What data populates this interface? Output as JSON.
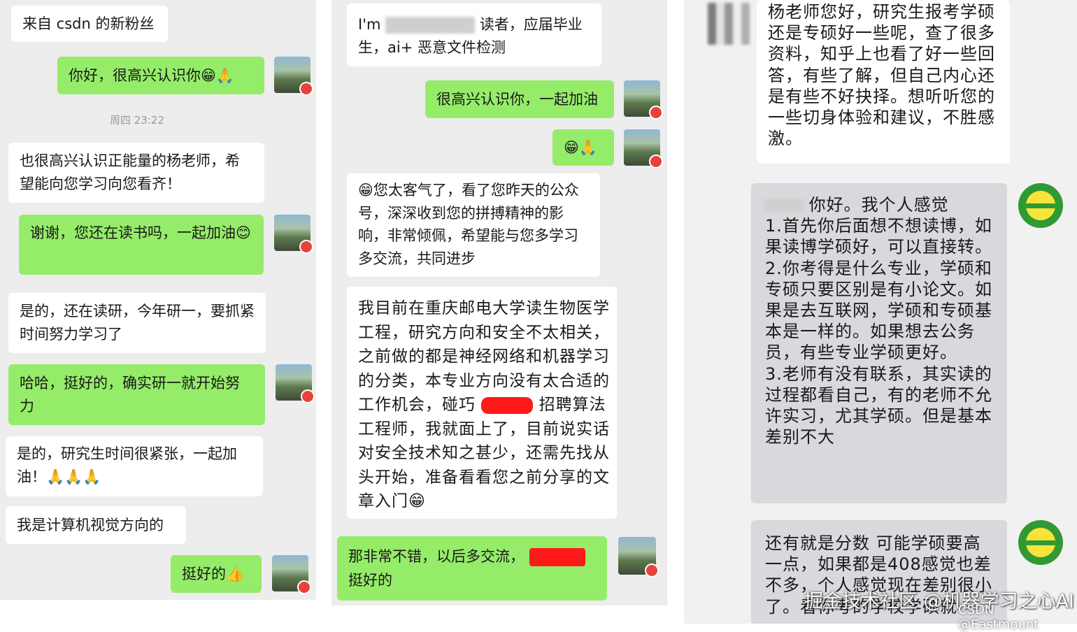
{
  "panel1": {
    "msg1": "来自 csdn 的新粉丝",
    "msg2": "你好，很高兴认识你😁🙏",
    "timestamp": "周四 23:22",
    "msg3": "也很高兴认识正能量的杨老师，希望能向您学习向您看齐！",
    "msg4": "谢谢，您还在读书吗，一起加油😊",
    "msg5": "是的，还在读研，今年研一，要抓紧时间努力学习了",
    "msg6": "哈哈，挺好的，确实研一就开始努力",
    "msg7": "是的，研究生时间很紧张，一起加油！🙏🙏🙏",
    "msg8": "我是计算机视觉方向的",
    "msg9": "挺好的👍"
  },
  "panel2": {
    "msg1_a": "I'm",
    "msg1_b": "读者，应届毕业生，ai+ 恶意文件检测",
    "msg2": "很高兴认识你，一起加油",
    "msg3": "😁🙏",
    "msg4": "😁您太客气了，看了您昨天的公众号，深深收到您的拼搏精神的影响，非常倾佩，希望能与您多学习多交流，共同进步",
    "msg5_a": "我目前在重庆邮电大学读生物医学工程，研究方向和安全不太相关，之前做的都是神经网络和机器学习的分类，本专业方向没有太合适的工作机会，碰巧",
    "msg5_b": "招聘算法工程师，我就面上了，目前说实话对安全技术知之甚少，还需先找从头开始，准备看看您之前分享的文章入门😁",
    "msg6_a": "那非常不错，以后多交流，",
    "msg6_b": "挺好的"
  },
  "panel3": {
    "msg1": "杨老师您好，研究生报考学硕还是专硕好一些呢，查了很多资料，知乎上也看了好一些回答，有些了解，但自己内心还是有些不好抉择。想听听您的一些切身体验和建议，不胜感激。",
    "msg2_a": "你好。我个人感觉",
    "msg2_b": "1.首先你后面想不想读博，如果读博学硕好，可以直接转。",
    "msg2_c": "2.你考得是什么专业，学硕和专硕只要区别是有小论文。如果是去互联网，学硕和专硕基本是一样的。如果想去公务员，有些专业学硕更好。",
    "msg2_d": "3.老师有没有联系，其实读的过程都看自己，有的老师不允许实习，尤其学硕。但是基本差别不大",
    "msg3": "还有就是分数 可能学硕要高一点，如果都是408感觉也差不多，个人感觉现在差别很小了。看你考的学校学硕就"
  },
  "watermark": "掘金技术社区 @机器学习之心AI",
  "watermark_small": "CSDN @Eastmount"
}
